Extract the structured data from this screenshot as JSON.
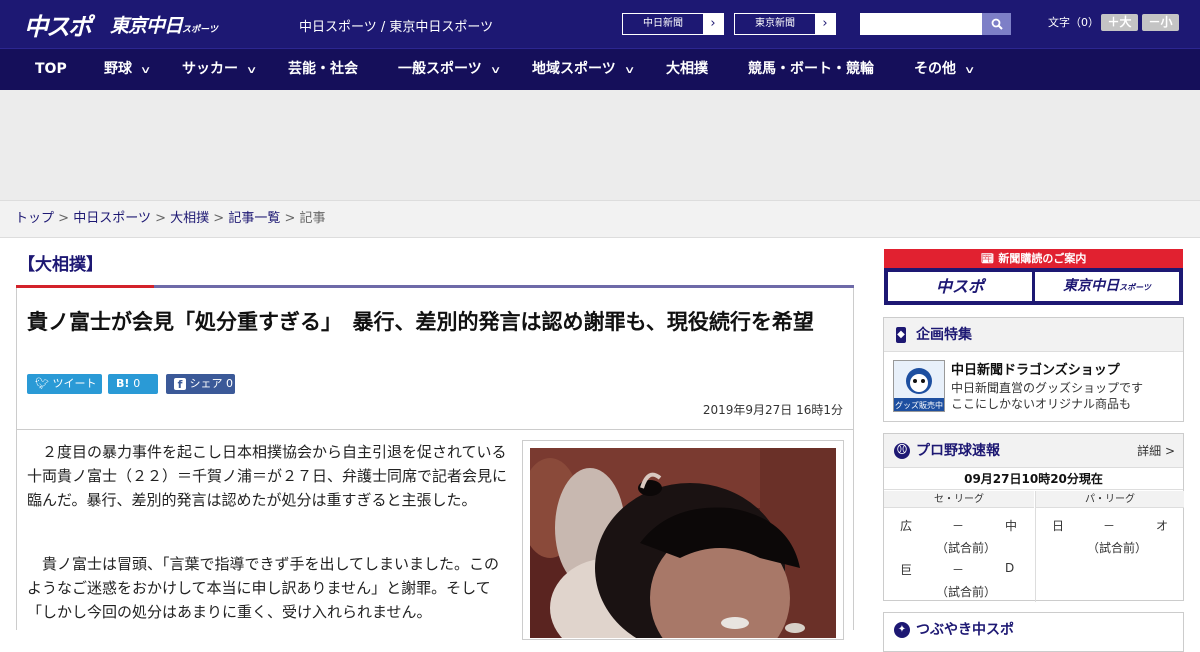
{
  "header": {
    "logo_chunichi": "中スポ",
    "logo_tokyo": "東京中日",
    "logo_tokyo_sub": "スポーツ",
    "site_name": "中日スポーツ / 東京中日スポーツ",
    "link_chunichi": "中日新聞",
    "link_tokyo": "東京新聞",
    "search_placeholder": "",
    "font_size_label": "文字（0）",
    "font_increase": "＋大",
    "font_decrease": "－小"
  },
  "nav": [
    {
      "label": "TOP",
      "has_menu": false
    },
    {
      "label": "野球",
      "has_menu": true
    },
    {
      "label": "サッカー",
      "has_menu": true
    },
    {
      "label": "芸能・社会",
      "has_menu": false
    },
    {
      "label": "一般スポーツ",
      "has_menu": true
    },
    {
      "label": "地域スポーツ",
      "has_menu": true
    },
    {
      "label": "大相撲",
      "has_menu": false
    },
    {
      "label": "競馬・ボート・競輪",
      "has_menu": false
    },
    {
      "label": "その他",
      "has_menu": true
    }
  ],
  "breadcrumb": {
    "items": [
      "トップ",
      "中日スポーツ",
      "大相撲",
      "記事一覧"
    ],
    "current": "記事",
    "separator": ">"
  },
  "article": {
    "category": "【大相撲】",
    "title": "貴ノ富士が会見「処分重すぎる」　暴行、差別的発言は認め謝罪も、現役続行を希望",
    "share_tweet": "ツイート",
    "share_hatena_label": "B!",
    "share_hatena_count": "0",
    "share_facebook": "シェア",
    "share_facebook_count": "0",
    "date": "2019年9月27日 16時1分",
    "paragraphs": [
      "２度目の暴力事件を起こし日本相撲協会から自主引退を促されている十両貴ノ富士（２２）＝千賀ノ浦＝が２７日、弁護士同席で記者会見に臨んだ。暴行、差別的発言は認めたが処分は重すぎると主張した。",
      "貴ノ富士は冒頭、「言葉で指導できず手を出してしまいました。このようなご迷惑をおかけして本当に申し訳ありません」と謝罪。そして「しかし今回の処分はあまりに重く、受け入れられません。"
    ]
  },
  "sidebar": {
    "subscribe_title": "新聞購読のご案内",
    "subscribe_chunichi": "中スポ",
    "subscribe_tokyo": "東京中日",
    "subscribe_tokyo_sub": "スポーツ",
    "feature_title": "企画特集",
    "shop_title": "中日新聞ドラゴンズショップ",
    "shop_desc_1": "中日新聞直営のグッズショップです",
    "shop_desc_2": "ここにしかないオリジナル商品も",
    "shop_badge": "グッズ販売中",
    "baseball_title": "プロ野球速報",
    "baseball_more": "詳細 >",
    "baseball_time": "09月27日10時20分現在",
    "central_label": "セ・リーグ",
    "pacific_label": "パ・リーグ",
    "games": [
      {
        "home": "広",
        "score": "－",
        "away": "中",
        "status": "（試合前）"
      },
      {
        "home": "巨",
        "score": "－",
        "away": "D",
        "status": "（試合前）"
      },
      {
        "home": "日",
        "score": "－",
        "away": "オ",
        "status": "（試合前）"
      }
    ],
    "next_title": "つぶやき中スポ"
  }
}
